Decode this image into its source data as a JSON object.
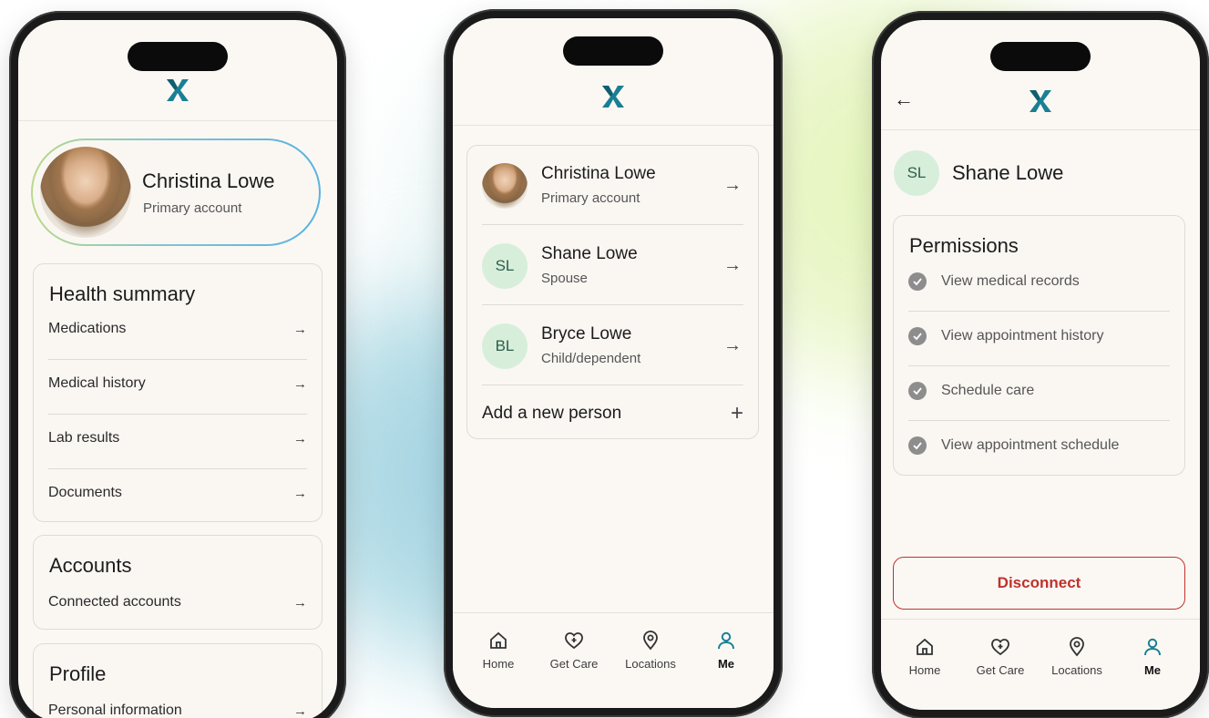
{
  "phone1": {
    "profile": {
      "name": "Christina Lowe",
      "subtitle": "Primary account"
    },
    "health_summary": {
      "title": "Health summary",
      "items": [
        {
          "label": "Medications"
        },
        {
          "label": "Medical history"
        },
        {
          "label": "Lab results"
        },
        {
          "label": "Documents"
        }
      ]
    },
    "accounts": {
      "title": "Accounts",
      "items": [
        {
          "label": "Connected accounts"
        }
      ]
    },
    "profile_section": {
      "title": "Profile",
      "items": [
        {
          "label": "Personal information"
        }
      ]
    }
  },
  "phone2": {
    "people": [
      {
        "name": "Christina Lowe",
        "role": "Primary account",
        "avatar": "photo"
      },
      {
        "name": "Shane Lowe",
        "role": "Spouse",
        "initials": "SL"
      },
      {
        "name": "Bryce Lowe",
        "role": "Child/dependent",
        "initials": "BL"
      }
    ],
    "add_label": "Add a new person",
    "add_icon": "+",
    "arrow_icon": "→"
  },
  "phone3": {
    "person": {
      "initials": "SL",
      "name": "Shane Lowe"
    },
    "back_icon": "←",
    "permissions": {
      "title": "Permissions",
      "items": [
        {
          "label": "View medical records"
        },
        {
          "label": "View appointment history"
        },
        {
          "label": "Schedule care"
        },
        {
          "label": "View appointment schedule"
        }
      ]
    },
    "disconnect_label": "Disconnect"
  },
  "nav": {
    "items": [
      {
        "label": "Home",
        "icon": "home-icon"
      },
      {
        "label": "Get Care",
        "icon": "heart-plus-icon"
      },
      {
        "label": "Locations",
        "icon": "location-pin-icon"
      },
      {
        "label": "Me",
        "icon": "person-icon"
      }
    ],
    "active": "Me"
  },
  "colors": {
    "brand": "#1a7f94",
    "avatar_bg": "#d7eedb",
    "disconnect": "#c0312b",
    "active_nav": "#1a7f94"
  },
  "arrow": "→"
}
